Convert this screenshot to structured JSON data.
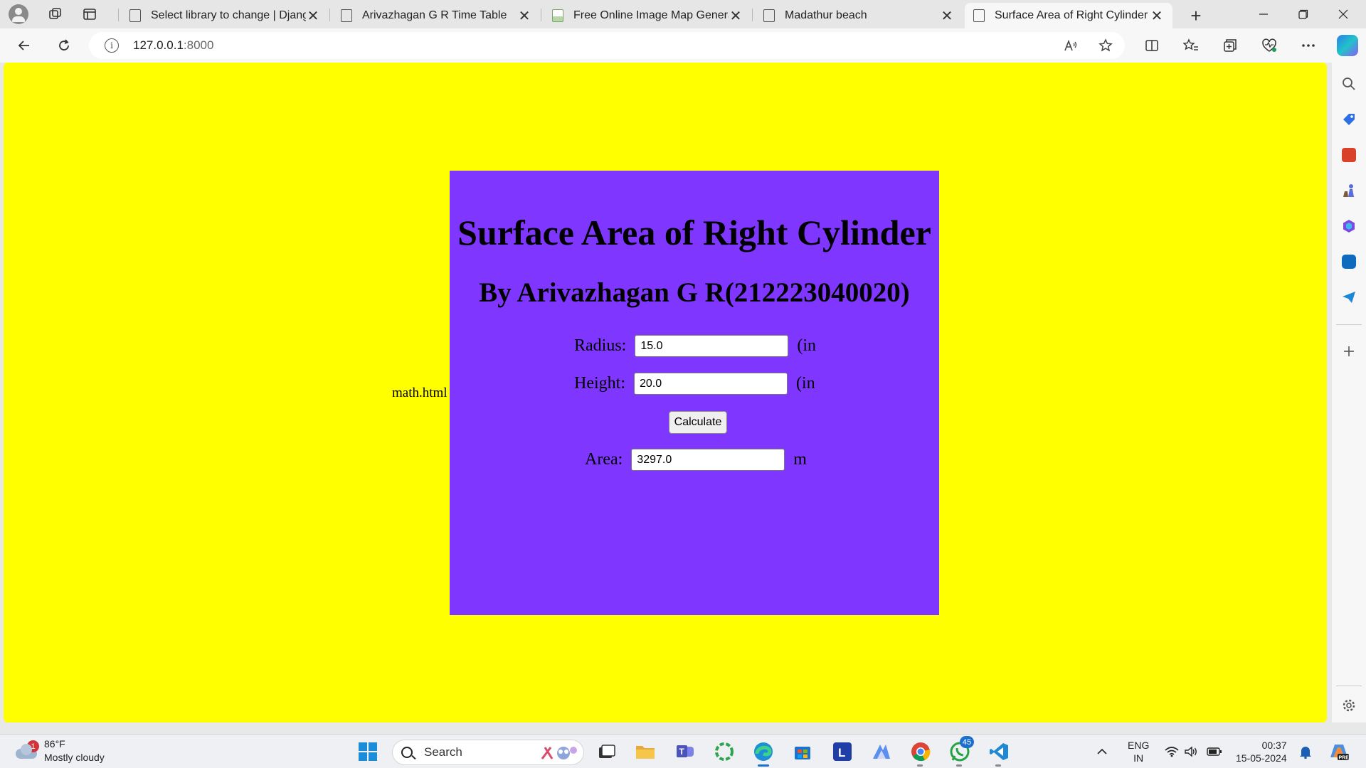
{
  "browser": {
    "tabs": [
      {
        "title": "Select library to change | Django",
        "favicon": "page-icon",
        "active": false
      },
      {
        "title": "Arivazhagan G R Time Table",
        "favicon": "page-icon",
        "active": false
      },
      {
        "title": "Free Online Image Map Generator",
        "favicon": "image-icon",
        "active": false
      },
      {
        "title": "Madathur beach",
        "favicon": "page-icon",
        "active": false
      },
      {
        "title": "Surface Area of Right Cylinder",
        "favicon": "page-icon",
        "active": true
      }
    ],
    "close_glyph": "✕",
    "new_tab_glyph": "+",
    "url_host": "127.0.0.1",
    "url_port": ":8000"
  },
  "page": {
    "background": "#ffff00",
    "card_color": "#7f36ff",
    "stray_text": "math.html",
    "title": "Surface Area of Right Cylinder",
    "subtitle": "By Arivazhagan G R(212223040020)",
    "radius": {
      "label": "Radius:",
      "value": "15.0",
      "unit": "(in"
    },
    "height": {
      "label": "Height:",
      "value": "20.0",
      "unit": "(in"
    },
    "calculate_label": "Calculate",
    "area": {
      "label": "Area:",
      "value": "3297.0",
      "unit": "m"
    }
  },
  "taskbar": {
    "weather_temp": "86°F",
    "weather_desc": "Mostly cloudy",
    "weather_badge": "1",
    "search_label": "Search",
    "whatsapp_badge": "45",
    "lang_line1": "ENG",
    "lang_line2": "IN",
    "time": "00:37",
    "date": "15-05-2024"
  }
}
